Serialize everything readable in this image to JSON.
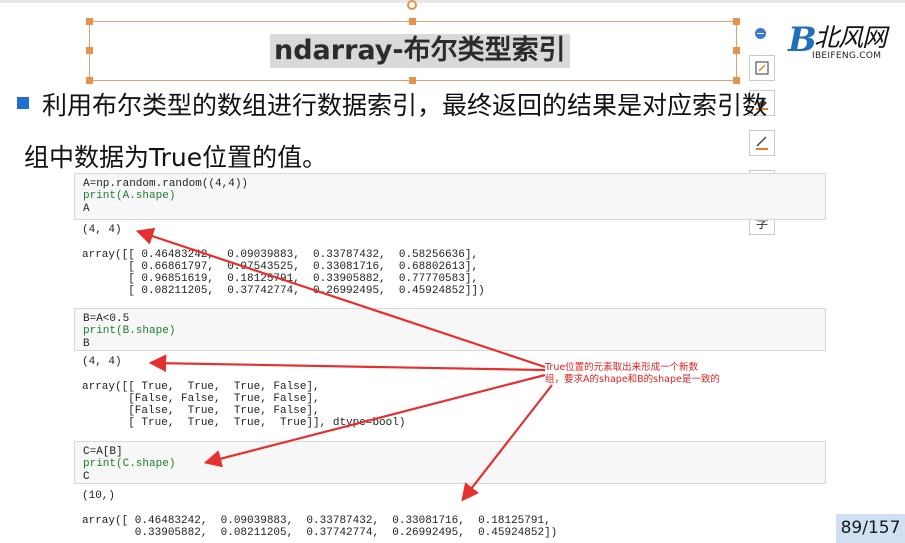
{
  "slide": {
    "title": "ndarray-布尔类型索引",
    "bullet_line1": "利用布尔类型的数组进行数据索引，最终返回的结果是对应索引数",
    "bullet_line2": "组中数据为True位置的值。",
    "page_number": "89/157",
    "annotation_line1": "True位置的元素取出来形成一个新数",
    "annotation_line2": "组，要求A的shape和B的shape是一致的"
  },
  "logo": {
    "cn": "北风网",
    "en": "IBEIFENG.COM"
  },
  "toolbar": {
    "icons": [
      "collapse-icon",
      "edit-icon",
      "fill-icon",
      "line-color-icon",
      "layers-icon",
      "text-icon"
    ],
    "text_button_label": "字"
  },
  "cells": [
    {
      "code": [
        "A=np.random.random((4,4))",
        "print(A.shape)",
        "A"
      ],
      "output": [
        "(4, 4)",
        "",
        "array([[ 0.46483242,  0.09039883,  0.33787432,  0.58256636],",
        "       [ 0.66861797,  0.97543525,  0.33081716,  0.68802613],",
        "       [ 0.96851619,  0.18125791,  0.33905882,  0.77770583],",
        "       [ 0.08211205,  0.37742774,  0.26992495,  0.45924852]])"
      ]
    },
    {
      "code": [
        "B=A<0.5",
        "print(B.shape)",
        "B"
      ],
      "output": [
        "(4, 4)",
        "",
        "array([[ True,  True,  True, False],",
        "       [False, False,  True, False],",
        "       [False,  True,  True, False],",
        "       [ True,  True,  True,  True]], dtype=bool)"
      ]
    },
    {
      "code": [
        "C=A[B]",
        "print(C.shape)",
        "C"
      ],
      "output": [
        "(10,)",
        "",
        "array([ 0.46483242,  0.09039883,  0.33787432,  0.33081716,  0.18125791,",
        "        0.33905882,  0.08211205,  0.37742774,  0.26992495,  0.45924852])"
      ]
    }
  ],
  "colors": {
    "arrow": "#e53030",
    "accent": "#1f6fd1",
    "handle": "#e8914a",
    "page_bg": "#cfe0f2"
  }
}
